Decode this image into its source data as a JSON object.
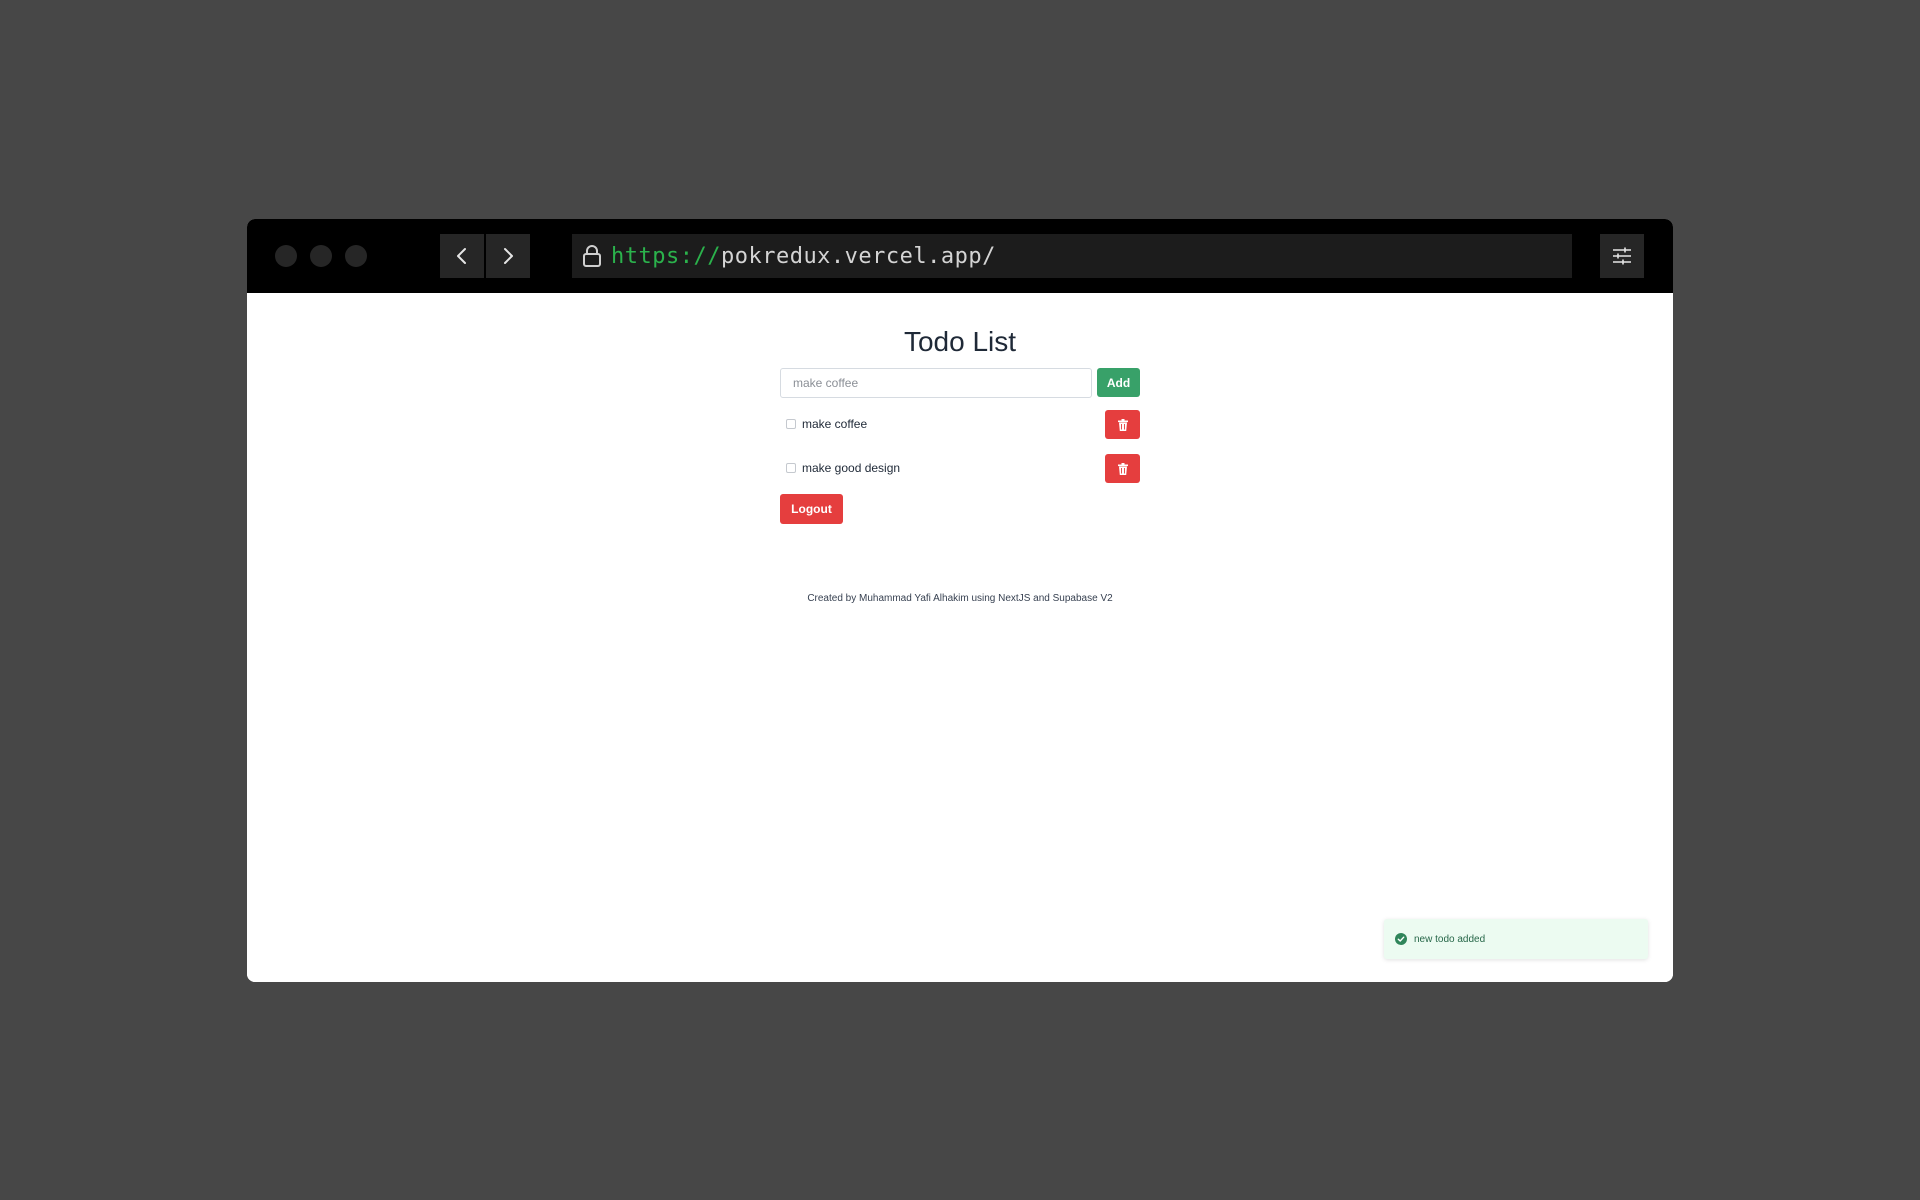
{
  "browser": {
    "url_scheme": "https://",
    "url_host": "pokredux.vercel.app/"
  },
  "page": {
    "title": "Todo List",
    "input_placeholder": "make coffee",
    "add_label": "Add",
    "todos": [
      {
        "label": "make coffee",
        "done": false
      },
      {
        "label": "make good design",
        "done": false
      }
    ],
    "logout_label": "Logout",
    "footer": "Created by Muhammad Yafi Alhakim using NextJS and Supabase V2"
  },
  "toast": {
    "message": "new todo added"
  },
  "colors": {
    "add_button": "#38a169",
    "delete_button": "#e53e3e",
    "logout_button": "#e53e3e",
    "url_scheme": "#2bb24c"
  }
}
